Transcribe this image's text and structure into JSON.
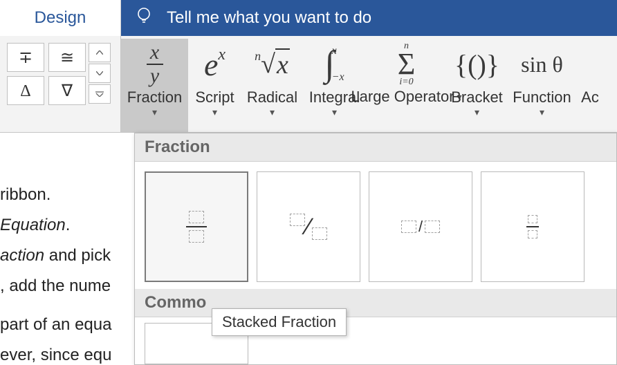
{
  "tabs": {
    "design": "Design"
  },
  "tellme": {
    "placeholder": "Tell me what you want to do"
  },
  "symbols": {
    "s0": "∓",
    "s1": "≅",
    "s2": "Δ",
    "s3": "∇"
  },
  "structures": {
    "fraction": "Fraction",
    "script": "Script",
    "radical": "Radical",
    "integral": "Integral",
    "large_operator": "Large Operator",
    "bracket": "Bracket",
    "function": "Function",
    "accent_partial": "Ac"
  },
  "icons": {
    "fraction_top": "x",
    "fraction_bot": "y",
    "script": "eˣ",
    "radical": "ⁿ√x",
    "integral": "∫",
    "integral_top": "x",
    "integral_bot": "−x",
    "sigma": "Σ",
    "sigma_top": "n",
    "sigma_bot": "i=0",
    "bracket": "{()}",
    "function": "sin θ"
  },
  "gallery": {
    "header_fraction": "Fraction",
    "header_common": "Common Fraction",
    "header_common_visible": "Commo",
    "tooltip": "Stacked Fraction"
  },
  "doc": {
    "l1": "ribbon.",
    "l2a": "Equation",
    "l2b": ".",
    "l3a": "action",
    "l3b": " and pick ",
    "l4": ", add the nume",
    "l5": "part of an equa",
    "l6": "ever, since equ"
  }
}
